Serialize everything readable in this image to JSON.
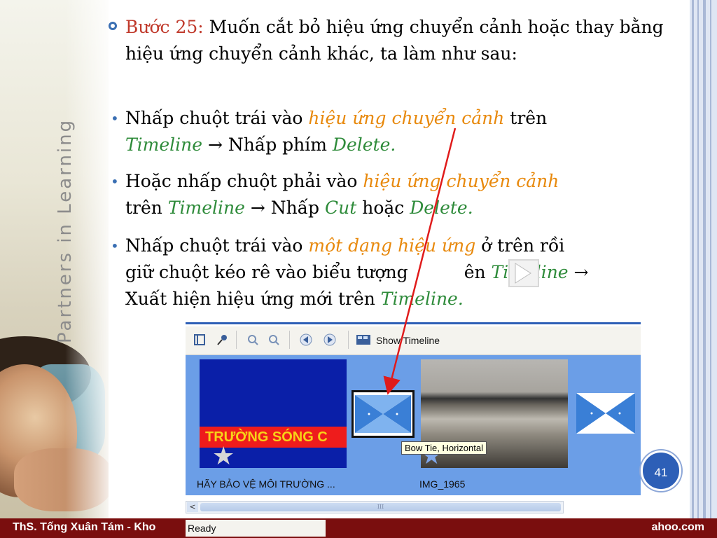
{
  "left_panel": {
    "vertical_text": "Partners in Learning"
  },
  "step": {
    "label": "Bước 25:",
    "text": "Muốn cắt bỏ hiệu ứng chuyển cảnh hoặc thay bằng hiệu ứng chuyển cảnh khác, ta làm như sau:"
  },
  "bullets": [
    {
      "part1": "Nhấp chuột trái vào ",
      "em1": "hiệu ứng chuyển cảnh",
      "part2": " trên ",
      "em2": "Timeline",
      "part3": " → Nhấp phím ",
      "em3": "Delete."
    },
    {
      "part1": "Hoặc nhấp chuột phải vào ",
      "em1": "hiệu ứng chuyển cảnh",
      "part2": "trên ",
      "em2": "Timeline",
      "part3": " → Nhấp ",
      "em3": "Cut",
      "part4": " hoặc ",
      "em4": "Delete."
    },
    {
      "part1": "Nhấp chuột trái vào ",
      "em1": "một dạng hiệu ứng",
      "part2": " ở trên rồi giữ chuột kéo rê vào biểu tượng",
      "part2b": "ên ",
      "em2": "Timeline",
      "arrow": " →",
      "part3": "Xuất hiện hiệu ứng mới trên ",
      "em3": "Timeline."
    }
  ],
  "screenshot": {
    "toolbar": {
      "show_timeline_label": "Show Timeline",
      "icons": [
        "storyboard-icon",
        "microphone-icon",
        "zoom-in-icon",
        "zoom-out-icon",
        "rewind-icon",
        "play-icon",
        "show-timeline-icon"
      ]
    },
    "clip1": {
      "banner_text": "TRƯỜNG SÓNG C",
      "label": "HÃY BẢO VỆ MÔI TRƯỜNG ..."
    },
    "clip2": {
      "label": "IMG_1965"
    },
    "tooltip": "Bow Tie, Horizontal",
    "scroll_thumb_grip": "III",
    "scroll_left_arrow": "<",
    "status": "Ready"
  },
  "page_number": "41",
  "footer": {
    "left": "ThS. Tống Xuân Tám - Kho",
    "right": "ahoo.com"
  },
  "colors": {
    "step_label": "#c0392b",
    "orange_text": "#e8890c",
    "green_text": "#2e8b3a",
    "footer_bg": "#7a0e0e",
    "page_badge": "#2d5fb7",
    "arrow": "#e01b1b"
  }
}
